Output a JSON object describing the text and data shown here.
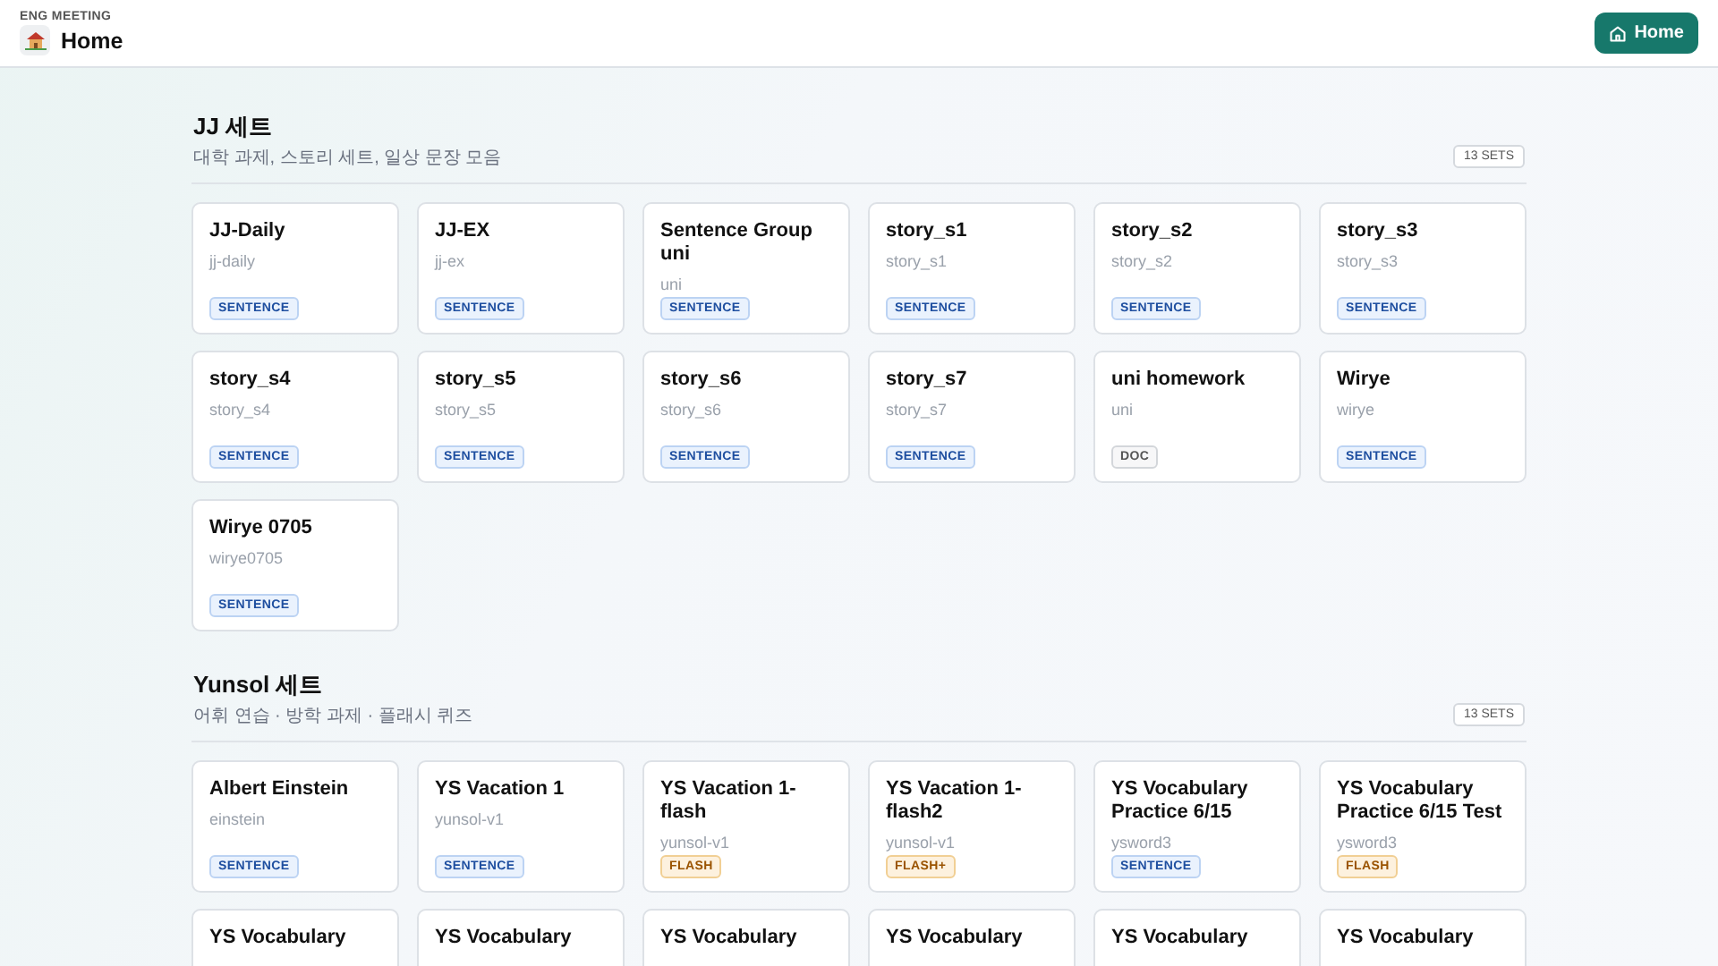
{
  "header": {
    "eyebrow": "ENG MEETING",
    "title": "Home",
    "button": "Home"
  },
  "sections": [
    {
      "title": "JJ 세트",
      "subtitle": "대학 과제, 스토리 세트, 일상 문장 모음",
      "count": "13 SETS",
      "cards": [
        {
          "title": "JJ-Daily",
          "slug": "jj-daily",
          "badge": {
            "label": "SENTENCE",
            "kind": "sentence"
          }
        },
        {
          "title": "JJ-EX",
          "slug": "jj-ex",
          "badge": {
            "label": "SENTENCE",
            "kind": "sentence"
          }
        },
        {
          "title": "Sentence Group uni",
          "slug": "uni",
          "badge": {
            "label": "SENTENCE",
            "kind": "sentence"
          }
        },
        {
          "title": "story_s1",
          "slug": "story_s1",
          "badge": {
            "label": "SENTENCE",
            "kind": "sentence"
          }
        },
        {
          "title": "story_s2",
          "slug": "story_s2",
          "badge": {
            "label": "SENTENCE",
            "kind": "sentence"
          }
        },
        {
          "title": "story_s3",
          "slug": "story_s3",
          "badge": {
            "label": "SENTENCE",
            "kind": "sentence"
          }
        },
        {
          "title": "story_s4",
          "slug": "story_s4",
          "badge": {
            "label": "SENTENCE",
            "kind": "sentence"
          }
        },
        {
          "title": "story_s5",
          "slug": "story_s5",
          "badge": {
            "label": "SENTENCE",
            "kind": "sentence"
          }
        },
        {
          "title": "story_s6",
          "slug": "story_s6",
          "badge": {
            "label": "SENTENCE",
            "kind": "sentence"
          }
        },
        {
          "title": "story_s7",
          "slug": "story_s7",
          "badge": {
            "label": "SENTENCE",
            "kind": "sentence"
          }
        },
        {
          "title": "uni homework",
          "slug": "uni",
          "badge": {
            "label": "DOC",
            "kind": "doc"
          }
        },
        {
          "title": "Wirye",
          "slug": "wirye",
          "badge": {
            "label": "SENTENCE",
            "kind": "sentence"
          }
        },
        {
          "title": "Wirye 0705",
          "slug": "wirye0705",
          "badge": {
            "label": "SENTENCE",
            "kind": "sentence"
          }
        }
      ]
    },
    {
      "title": "Yunsol 세트",
      "subtitle": "어휘 연습 · 방학 과제 · 플래시 퀴즈",
      "count": "13 SETS",
      "cards": [
        {
          "title": "Albert Einstein",
          "slug": "einstein",
          "badge": {
            "label": "SENTENCE",
            "kind": "sentence"
          }
        },
        {
          "title": "YS Vacation 1",
          "slug": "yunsol-v1",
          "badge": {
            "label": "SENTENCE",
            "kind": "sentence"
          }
        },
        {
          "title": "YS Vacation 1-flash",
          "slug": "yunsol-v1",
          "badge": {
            "label": "FLASH",
            "kind": "flash"
          }
        },
        {
          "title": "YS Vacation 1-flash2",
          "slug": "yunsol-v1",
          "badge": {
            "label": "FLASH+",
            "kind": "flash"
          }
        },
        {
          "title": "YS Vocabulary Practice 6/15",
          "slug": "ysword3",
          "badge": {
            "label": "SENTENCE",
            "kind": "sentence"
          }
        },
        {
          "title": "YS Vocabulary Practice 6/15 Test",
          "slug": "ysword3",
          "badge": {
            "label": "FLASH",
            "kind": "flash"
          }
        },
        {
          "title": "YS Vocabulary"
        },
        {
          "title": "YS Vocabulary"
        },
        {
          "title": "YS Vocabulary"
        },
        {
          "title": "YS Vocabulary"
        },
        {
          "title": "YS Vocabulary"
        },
        {
          "title": "YS Vocabulary"
        }
      ]
    }
  ]
}
